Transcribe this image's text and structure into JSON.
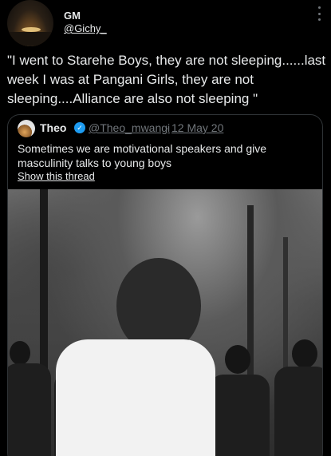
{
  "tweet": {
    "display_name": "GM",
    "handle": "@Gichy_",
    "text": "\"I went to Starehe Boys, they are not sleeping......last week I was at Pangani Girls, they are not sleeping....Alliance are also not sleeping \""
  },
  "quoted_tweet": {
    "display_name": "Theo",
    "handle": "@Theo_mwangi",
    "separator": "·",
    "date": "12 May 20",
    "text": "Sometimes we are motivational speakers and give masculinity talks to young boys",
    "show_thread": "Show this thread"
  },
  "icons": {
    "more": "more-vertical-icon",
    "verified": "verified-badge-icon"
  },
  "colors": {
    "background": "#000000",
    "text": "#e7e9ea",
    "secondary_text": "#71767b",
    "verified": "#1d9bf0",
    "border": "#2f3336"
  }
}
